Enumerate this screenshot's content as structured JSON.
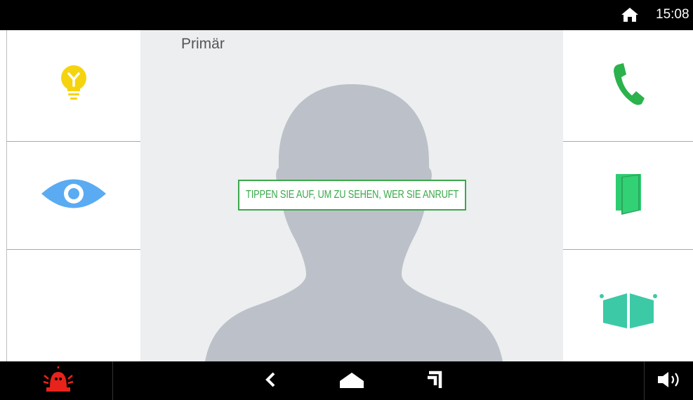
{
  "status_bar": {
    "time": "15:08",
    "home_icon": "home-icon"
  },
  "video": {
    "caller_name": "Primär",
    "tap_prompt": "TIPPEN SIE AUF, UM ZU SEHEN, WER SIE ANRUFT"
  },
  "left_panel": {
    "buttons": [
      {
        "icon": "lightbulb-icon",
        "color": "#f5d40f"
      },
      {
        "icon": "eye-icon",
        "color": "#5aabf2"
      },
      {
        "icon": "",
        "color": ""
      }
    ]
  },
  "right_panel": {
    "buttons": [
      {
        "icon": "phone-icon",
        "color": "#2bb24c"
      },
      {
        "icon": "door-icon",
        "color": "#2ecc71"
      },
      {
        "icon": "gate-icon",
        "color": "#3cc9a6"
      }
    ]
  },
  "nav_bar": {
    "alarm_icon": "alarm-icon",
    "alarm_color": "#e8231b",
    "back_icon": "back-icon",
    "home_icon": "home-icon",
    "recents_icon": "recents-icon",
    "volume_icon": "volume-icon"
  }
}
